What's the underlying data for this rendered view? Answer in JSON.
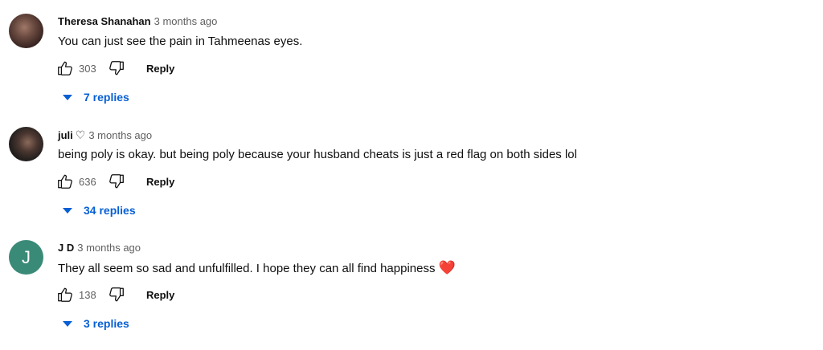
{
  "comments": [
    {
      "author": "Theresa Shanahan",
      "author_heart": "",
      "time": "3 months ago",
      "text": "You can just see the pain in Tahmeenas eyes.",
      "emoji": "",
      "likes": "303",
      "reply_label": "Reply",
      "replies_label": "7 replies",
      "avatar_type": "photo"
    },
    {
      "author": "juli",
      "author_heart": "♡",
      "time": "3 months ago",
      "text": "being poly is okay. but being poly because your husband cheats is just a red flag on both sides lol",
      "emoji": "",
      "likes": "636",
      "reply_label": "Reply",
      "replies_label": "34 replies",
      "avatar_type": "photo"
    },
    {
      "author": "J D",
      "author_heart": "",
      "time": "3 months ago",
      "text": "They all seem so sad and unfulfilled. I hope they can all find happiness",
      "emoji": "❤️",
      "likes": "138",
      "reply_label": "Reply",
      "replies_label": "3 replies",
      "avatar_type": "letter",
      "avatar_letter": "J",
      "avatar_color": "#3a8a78"
    }
  ],
  "colors": {
    "link_blue": "#065fd4",
    "secondary_text": "#606060",
    "primary_text": "#0f0f0f"
  },
  "icons": [
    "thumbs-up-icon",
    "thumbs-down-icon",
    "caret-down-icon",
    "heart-icon"
  ]
}
